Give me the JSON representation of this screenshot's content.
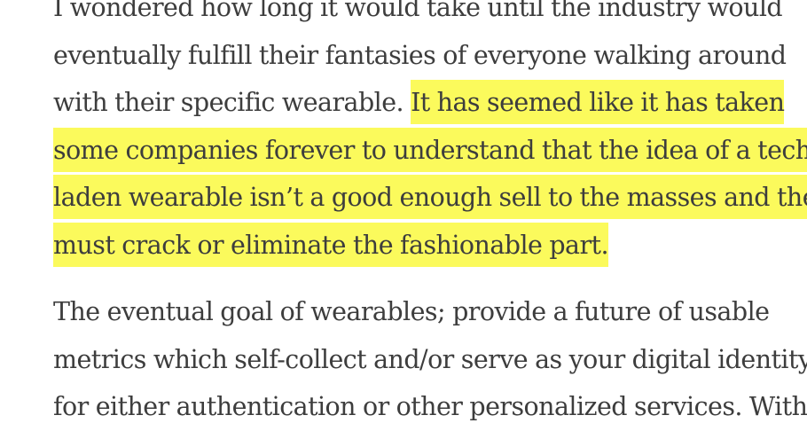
{
  "article": {
    "paragraph1": {
      "line1": "I wondered how long it would take until the industry would",
      "line2": "eventually fulfill their fantasies of everyone walking around",
      "line3_plain": "with their specific wearable. ",
      "line3_highlight": "It has seemed like it has taken",
      "line4_highlight": "some companies forever to understand that the idea of a tech-",
      "line5_highlight": "laden wearable isn’t a good enough sell to the masses and they",
      "line6_highlight": "must crack or eliminate the fashionable part."
    },
    "paragraph2": {
      "line1": "The eventual goal of wearables; provide a future of usable",
      "line2": "metrics which self-collect and/or serve as your digital identity",
      "line3": "for either authentication or other personalized services. With"
    }
  },
  "colors": {
    "text": "#3d3d3d",
    "highlight": "#fbfa5c",
    "background": "#ffffff"
  }
}
